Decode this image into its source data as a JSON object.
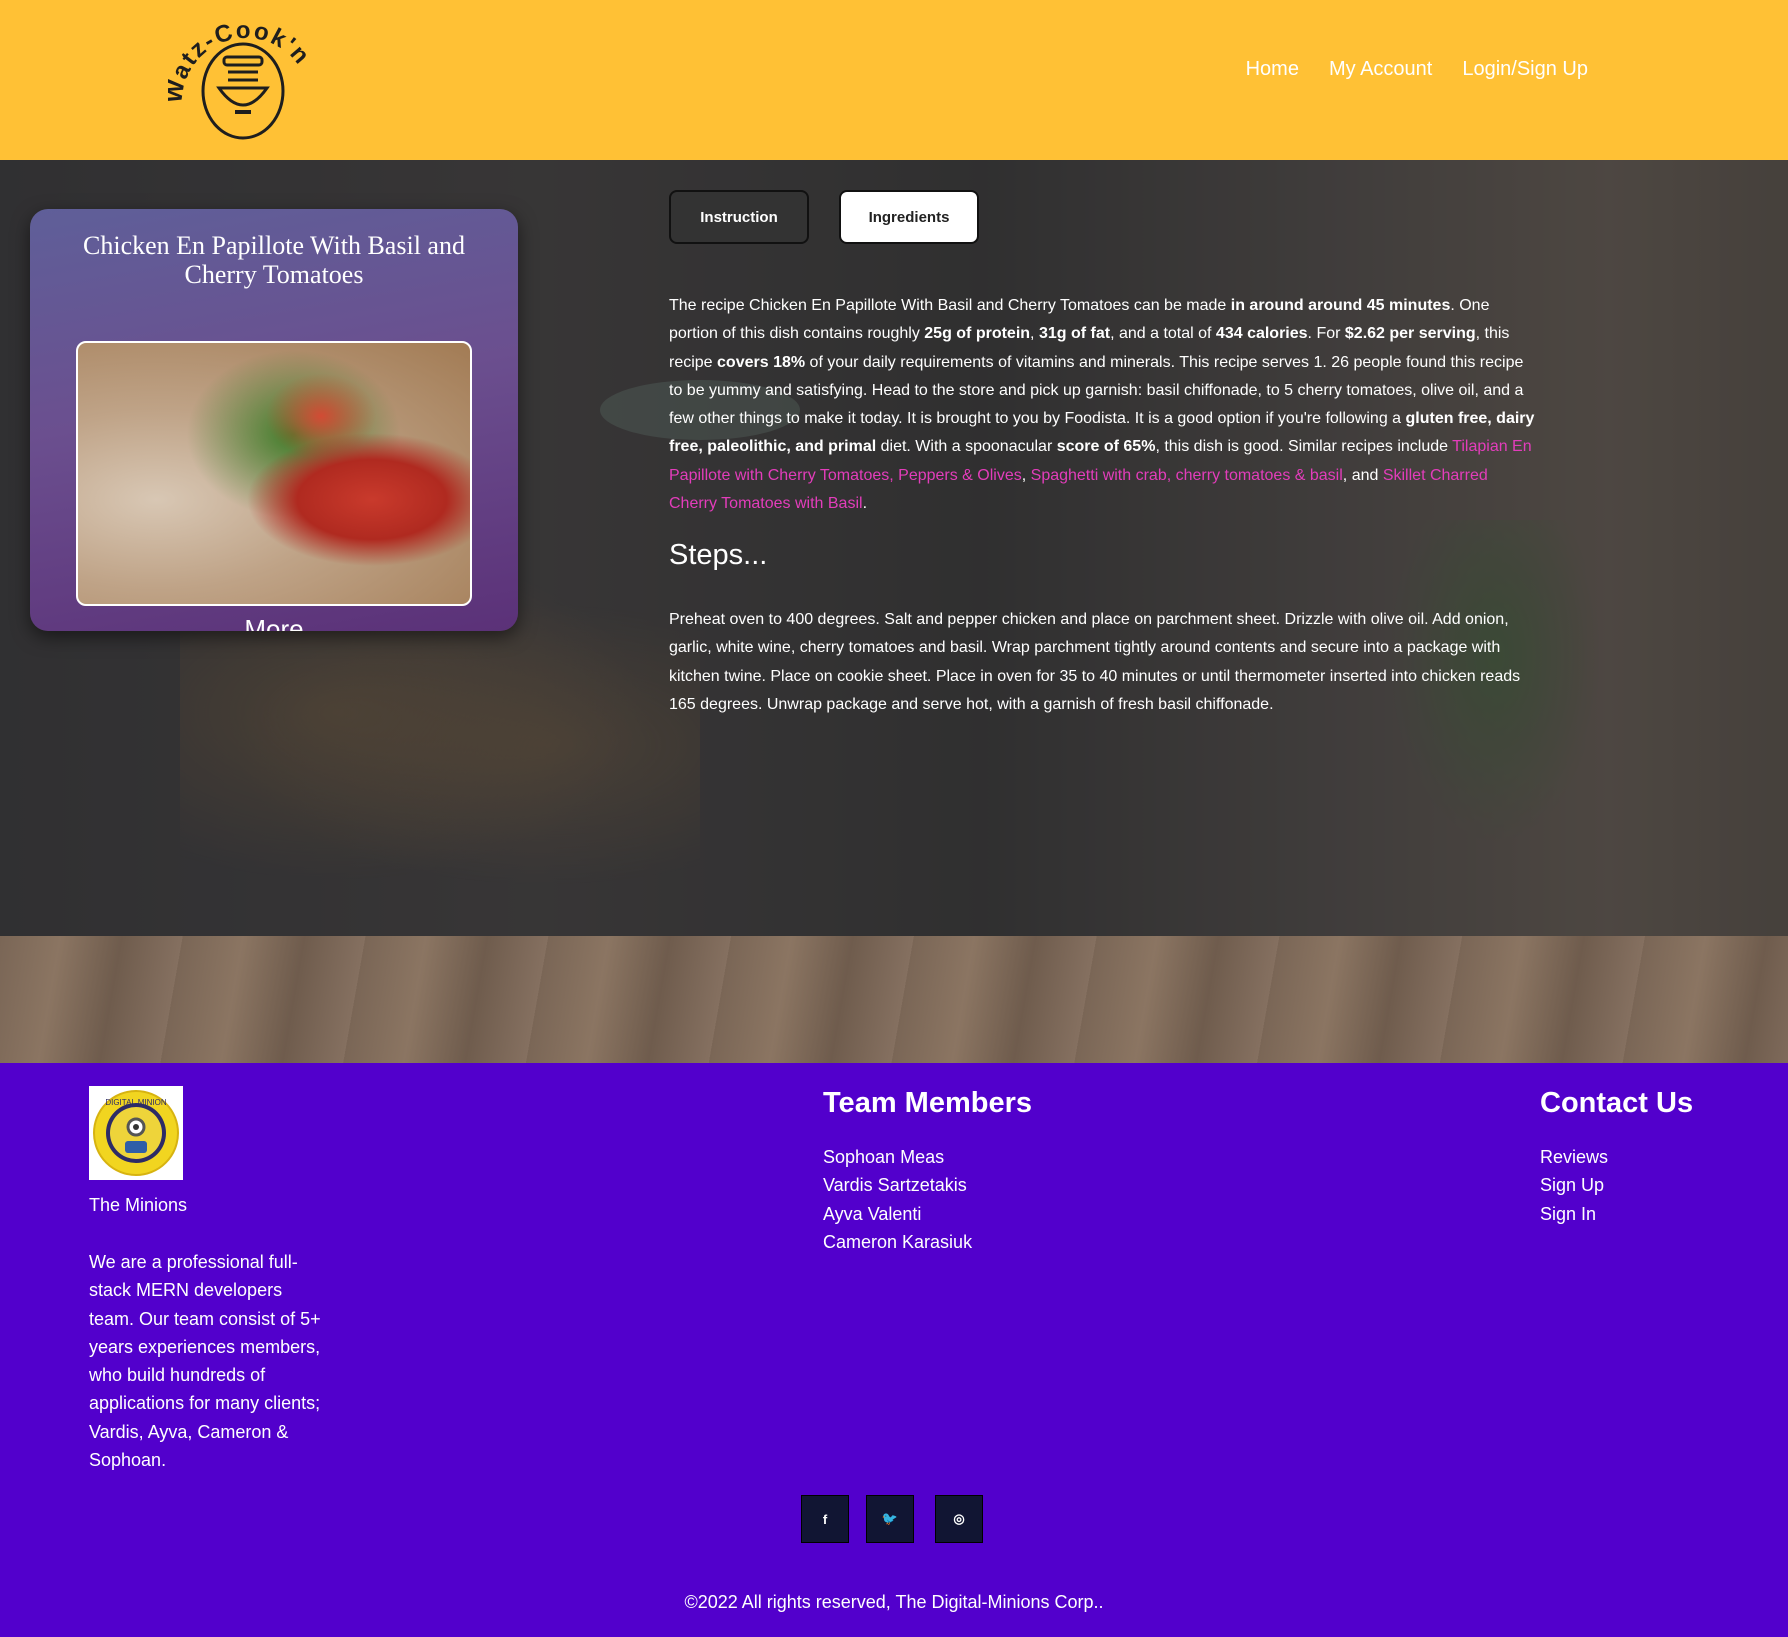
{
  "header": {
    "logo_text": "Watz-Cook'n",
    "nav": [
      "Home",
      "My Account",
      "Login/Sign Up"
    ]
  },
  "recipe": {
    "title": "Chicken En Papillote With Basil and Cherry Tomatoes",
    "more_label": "More",
    "tabs": {
      "instruction": "Instruction",
      "ingredients": "Ingredients"
    },
    "summary": {
      "t1": "The recipe Chicken En Papillote With Basil and Cherry Tomatoes can be made ",
      "b1": "in around around 45 minutes",
      "t2": ". One portion of this dish contains roughly ",
      "b2": "25g of protein",
      "t3": ", ",
      "b3": "31g of fat",
      "t4": ", and a total of ",
      "b4": "434 calories",
      "t5": ". For ",
      "b5": "$2.62 per serving",
      "t6": ", this recipe ",
      "b6": "covers 18%",
      "t7": " of your daily requirements of vitamins and minerals. This recipe serves 1. 26 people found this recipe to be yummy and satisfying. Head to the store and pick up garnish: basil chiffonade, to 5 cherry tomatoes, olive oil, and a few other things to make it today. It is brought to you by Foodista. It is a good option if you're following a ",
      "b7": "gluten free, dairy free, paleolithic, and primal",
      "t8": " diet. With a spoonacular ",
      "b8": "score of 65%",
      "t9": ", this dish is good. Similar recipes include ",
      "l1": "Tilapian En Papillote with Cherry Tomatoes, Peppers & Olives",
      "t10": ", ",
      "l2": "Spaghetti with crab, cherry tomatoes & basil",
      "t11": ", and ",
      "l3": "Skillet Charred Cherry Tomatoes with Basil",
      "t12": "."
    },
    "steps_heading": "Steps...",
    "steps_text": "Preheat oven to 400 degrees. Salt and pepper chicken and place on parchment sheet. Drizzle with olive oil. Add onion, garlic, white wine, cherry tomatoes and basil. Wrap parchment tightly around contents and secure into a package with kitchen twine. Place on cookie sheet. Place in oven for 35 to 40 minutes or until thermometer inserted into chicken reads 165 degrees. Unwrap package and serve hot, with a garnish of fresh basil chiffonade."
  },
  "footer": {
    "logo_text": "DIGITAL MINION",
    "team_name": "The Minions",
    "about": "We are a professional full-stack MERN developers team. Our team consist of 5+ years experiences members, who build hundreds of applications for many clients; Vardis, Ayva, Cameron & Sophoan.",
    "team_heading": "Team Members",
    "team": [
      "Sophoan Meas",
      "Vardis Sartzetakis",
      "Ayva Valenti",
      "Cameron Karasiuk"
    ],
    "contact_heading": "Contact Us",
    "contact": [
      "Reviews",
      "Sign Up",
      "Sign In"
    ],
    "social": [
      {
        "icon": "facebook-icon",
        "glyph": "f"
      },
      {
        "icon": "twitter-icon",
        "glyph": "🐦"
      },
      {
        "icon": "instagram-icon",
        "glyph": "◎"
      }
    ],
    "copyright": "©2022 All rights reserved, The Digital-Minions Corp.."
  },
  "colors": {
    "header_bg": "#ffc135",
    "footer_bg": "#5200cc",
    "link_color": "#e33dbb",
    "card_bg": "#6b4f8f"
  }
}
